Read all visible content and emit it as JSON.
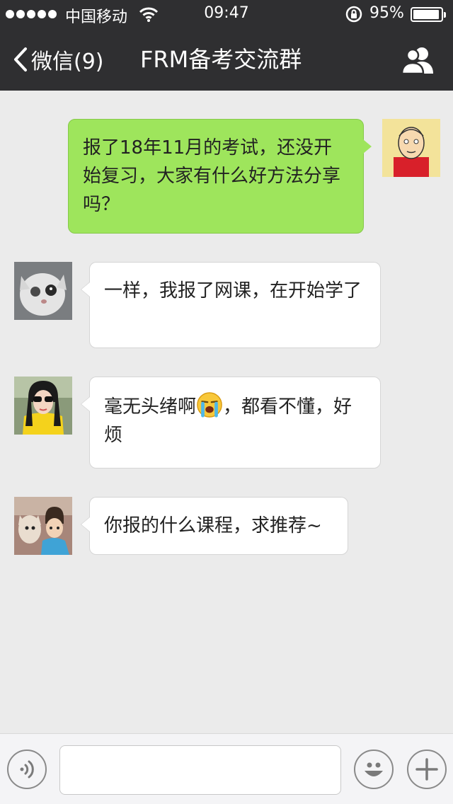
{
  "status_bar": {
    "carrier": "中国移动",
    "time": "09:47",
    "battery_percent": "95%",
    "battery_level": 0.95,
    "signal_icon": "signal-dots-icon",
    "wifi_icon": "wifi-icon",
    "lock_icon": "rotation-lock-icon"
  },
  "nav": {
    "back_label": "微信(9)",
    "title": "FRM备考交流群",
    "members_icon": "group-members-icon"
  },
  "messages": [
    {
      "direction": "outgoing",
      "avatar": "cartoon-man-avatar",
      "text": "报了18年11月的考试，还没开始复习，大家有什么好方法分享吗？"
    },
    {
      "direction": "incoming",
      "avatar": "cat-avatar",
      "text": "一样，我报了网课，在开始学了"
    },
    {
      "direction": "incoming",
      "avatar": "woman-sunglasses-avatar",
      "text_before": "毫无头绪啊",
      "emoji": "crying-face-emoji",
      "text_after": "，都看不懂，好烦"
    },
    {
      "direction": "incoming",
      "avatar": "child-with-dog-avatar",
      "text": "你报的什么课程，求推荐~"
    }
  ],
  "input_bar": {
    "voice_icon": "voice-icon",
    "emoji_icon": "emoji-icon",
    "plus_icon": "plus-icon",
    "text_value": ""
  },
  "colors": {
    "bar_background": "#2f2f31",
    "chat_background": "#ebebeb",
    "outgoing_bubble": "#9ee55c",
    "incoming_bubble": "#ffffff"
  }
}
